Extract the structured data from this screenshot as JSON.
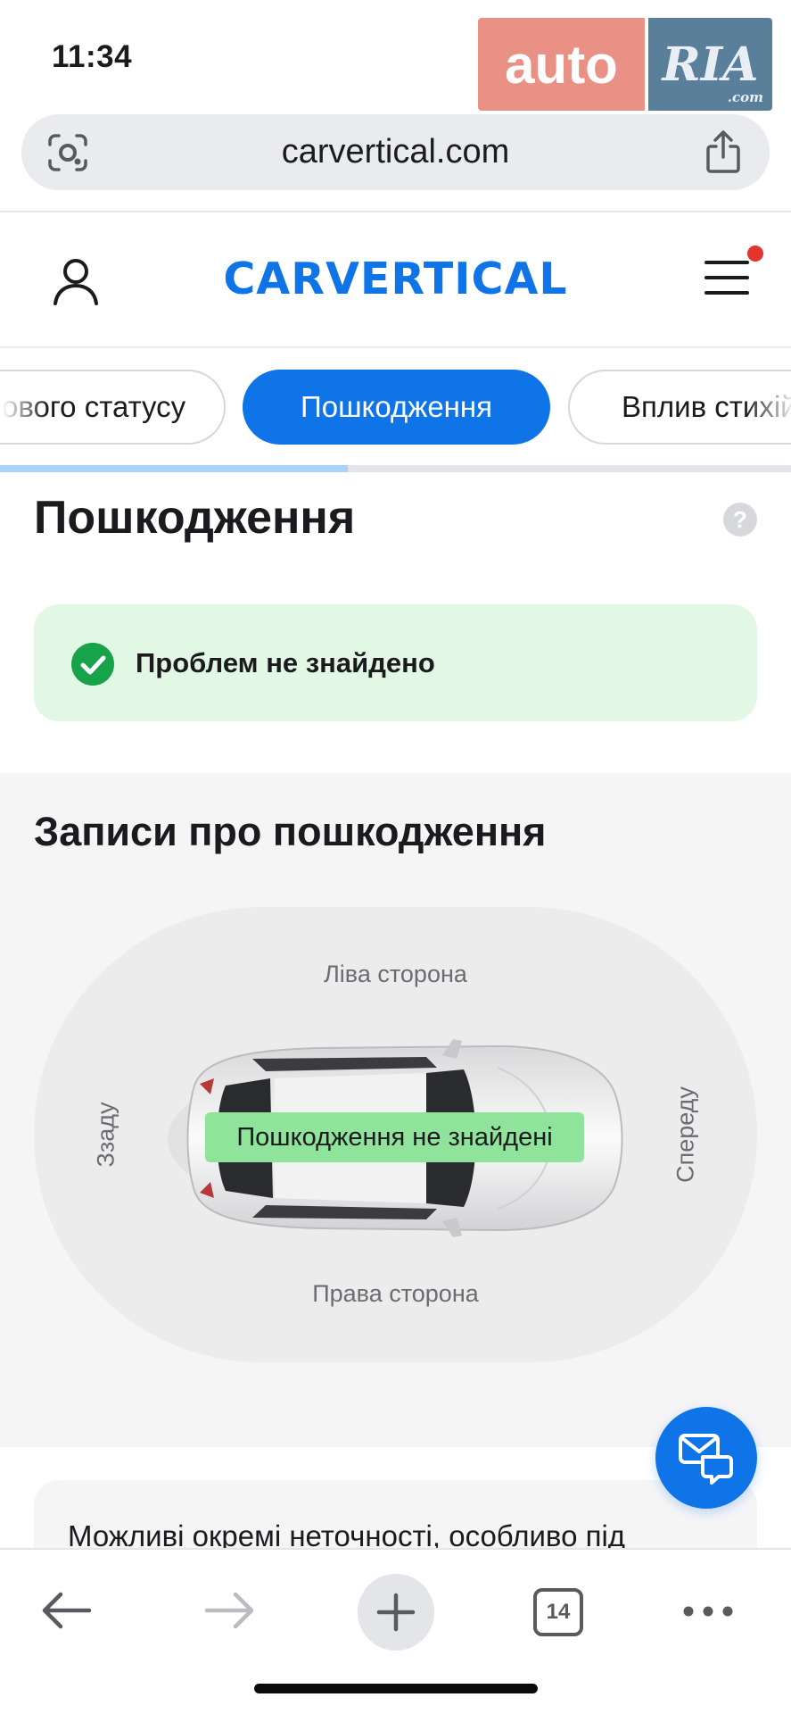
{
  "status_bar": {
    "time": "11:34"
  },
  "watermark": {
    "left": "auto",
    "right": "RIA",
    "suffix": ".com"
  },
  "browser": {
    "url": "carvertical.com"
  },
  "header": {
    "logo": "CARVERTICAL"
  },
  "tabs": [
    {
      "label": "ового статусу"
    },
    {
      "label": "Пошкодження",
      "active": true
    },
    {
      "label": "Вплив стихій"
    }
  ],
  "progress_fraction": 0.44,
  "section": {
    "title": "Пошкодження",
    "help": "?",
    "status_text": "Проблем не знайдено"
  },
  "records": {
    "title": "Записи про пошкодження",
    "left_side": "Ліва сторона",
    "right_side": "Права сторона",
    "rear": "Ззаду",
    "front": "Спереду",
    "badge": "Пошкодження не знайдені"
  },
  "note": {
    "text": "Можливі окремі неточності, особливо під"
  },
  "toolbar": {
    "tab_count": "14"
  },
  "colors": {
    "brand": "#0f74e8",
    "success": "#16a34a",
    "success_bg": "#e3f8e4",
    "badge": "#8fe39a",
    "notify": "#e2352f"
  }
}
